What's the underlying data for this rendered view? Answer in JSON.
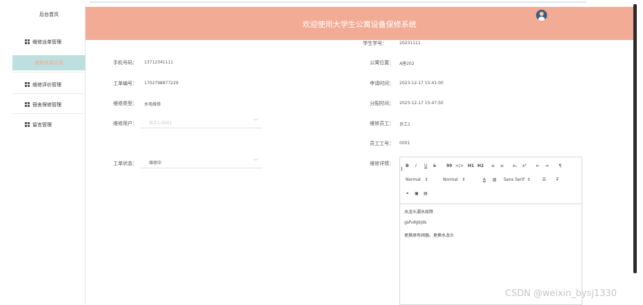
{
  "sidebar": {
    "home": "后台首页",
    "items": [
      {
        "label": "维修派单管理"
      },
      {
        "label": "维修派单记录"
      },
      {
        "label": "维修评价管理"
      },
      {
        "label": "宿舍保修管理"
      },
      {
        "label": "留言管理"
      }
    ]
  },
  "header": {
    "title": "欢迎使用大学生公寓设备保修系统"
  },
  "form": {
    "student_id_label": "学生学号：",
    "student_id_value": "20231111",
    "phone_label": "手机号码：",
    "phone_value": "13712341111",
    "dorm_label": "公寓位置：",
    "dorm_value": "A座202",
    "order_no_label": "工单编号：",
    "order_no_value": "1702798877229",
    "apply_time_label": "申请时间：",
    "apply_time_value": "2023-12-17 15:41:00",
    "repair_type_label": "维修类型：",
    "repair_type_value": "水电维修",
    "assign_time_label": "分配时间：",
    "assign_time_value": "2023-12-17 15:47:50",
    "repair_user_label": "维修用户：",
    "repair_user_value": "员工1-0001",
    "repair_staff_label": "维修员工：",
    "repair_staff_value": "员工1",
    "staff_no_label": "员工工号：",
    "staff_no_value": "0001",
    "status_label": "工单状态：",
    "status_value": "维修中",
    "details_label": "维修详情："
  },
  "editor": {
    "toolbar_row1": [
      "B",
      "I",
      "U",
      "S",
      "99",
      "</>",
      "H1",
      "H2",
      "≡",
      "≡",
      "x₂",
      "x²",
      "⇤",
      "⇥",
      "¶"
    ],
    "font_size_1": "Normal",
    "font_size_2": "Normal",
    "font_family": "Sans Serif",
    "content_lines": [
      "水龙头漏水故障",
      "gsfvdgkjds",
      "更换原有阀器、更换水龙头"
    ]
  },
  "watermark": "CSDN @weixin_bysj1330"
}
